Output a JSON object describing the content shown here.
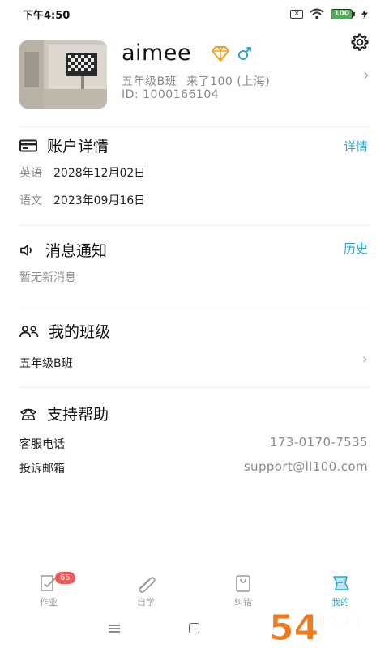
{
  "status_bar": {
    "time": "下午4:50",
    "battery": "100"
  },
  "profile": {
    "username": "aimee",
    "class_name": "五年级B班",
    "visits": "来了100 (上海)",
    "id": "ID: 1000166104"
  },
  "account": {
    "title": "账户详情",
    "link": "详情",
    "items": [
      {
        "subject": "英语",
        "date": "2028年12月02日"
      },
      {
        "subject": "语文",
        "date": "2023年09月16日"
      }
    ]
  },
  "messages": {
    "title": "消息通知",
    "link": "历史",
    "empty": "暂无新消息"
  },
  "my_class": {
    "title": "我的班级",
    "class_name": "五年级B班"
  },
  "support": {
    "title": "支持帮助",
    "phone_label": "客服电话",
    "phone": "173-0170-7535",
    "email_label": "投诉邮箱",
    "email": "support@ll100.com"
  },
  "tabs": [
    {
      "label": "作业",
      "badge": "65",
      "active": false
    },
    {
      "label": "自学",
      "active": false
    },
    {
      "label": "纠错",
      "active": false
    },
    {
      "label": "我的",
      "active": true
    }
  ],
  "watermark": {
    "brand": "手游网",
    "number": "54"
  },
  "colors": {
    "accent": "#2fa7c6",
    "badge": "#f05a5a",
    "vip": "#f0a31c"
  }
}
